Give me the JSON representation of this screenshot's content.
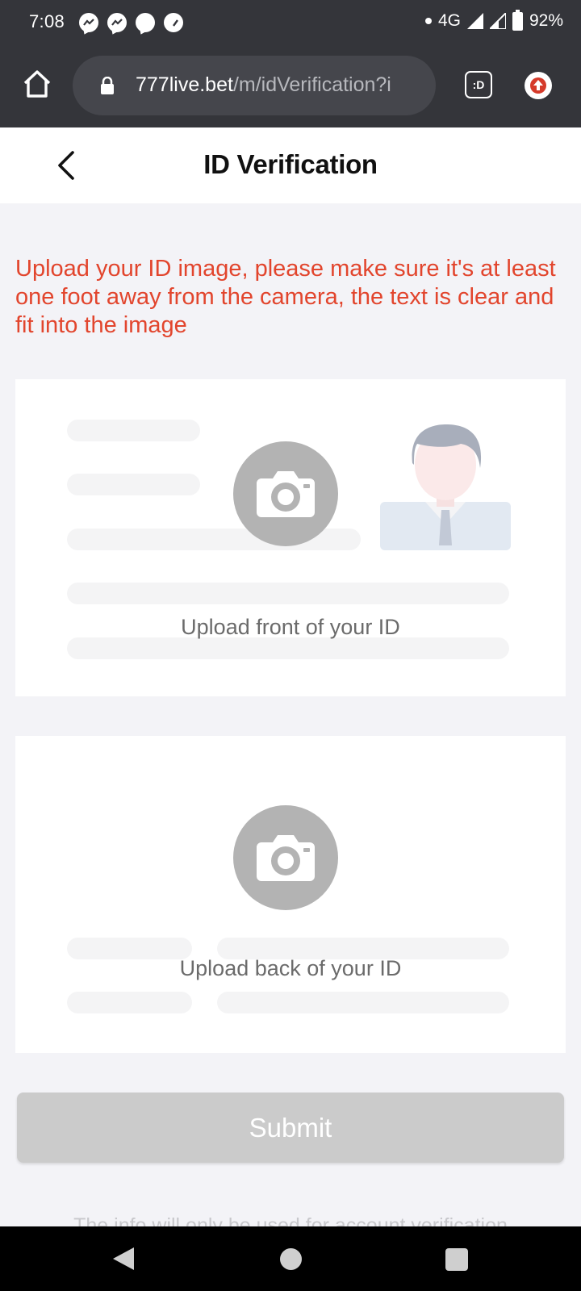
{
  "status_bar": {
    "time": "7:08",
    "network": "4G",
    "battery": "92%",
    "notification_icons": [
      "messenger-icon",
      "messenger-icon",
      "chat-bubble-icon",
      "speedometer-icon"
    ]
  },
  "browser": {
    "url_host": "777live.bet",
    "url_path": "/m/idVerification?i",
    "reader_mode_label": ":D"
  },
  "header": {
    "title": "ID Verification"
  },
  "instruction": "Upload your ID image, please make sure it's at least one foot away from the camera, the text is clear and fit into the image",
  "upload_front": {
    "label": "Upload front of your ID"
  },
  "upload_back": {
    "label": "Upload back of your ID"
  },
  "submit_label": "Submit",
  "footer_note": "The info will only be used for account verification",
  "colors": {
    "accent_warning": "#e2452d",
    "submit_disabled": "#cbcbcb",
    "chrome_dark": "#34353a"
  }
}
